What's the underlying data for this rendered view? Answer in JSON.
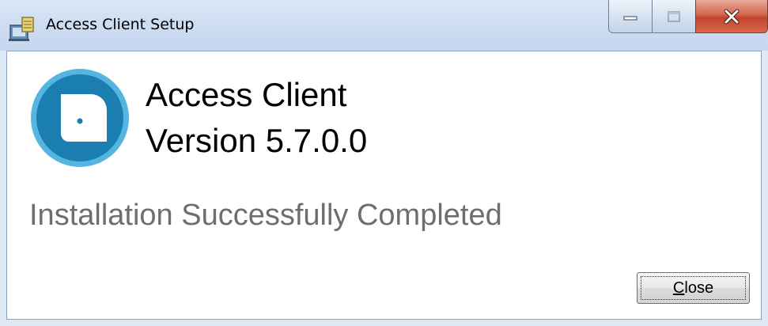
{
  "window": {
    "title": "Access Client Setup",
    "app_icon": "installer-icon",
    "caption_buttons": {
      "minimize_icon": "minimize-icon",
      "maximize_icon": "maximize-icon",
      "close_icon": "close-icon"
    }
  },
  "main": {
    "logo_icon": "access-client-logo-icon",
    "product_name": "Access Client",
    "product_version": "Version 5.7.0.0",
    "status": "Installation Successfully Completed"
  },
  "footer": {
    "close_button": {
      "mnemonic": "C",
      "rest": "lose"
    }
  },
  "colors": {
    "logo_blue": "#1a7fb0",
    "logo_ring": "#55b4e0",
    "status_gray": "#6e6e6e",
    "close_red": "#c2432a"
  }
}
